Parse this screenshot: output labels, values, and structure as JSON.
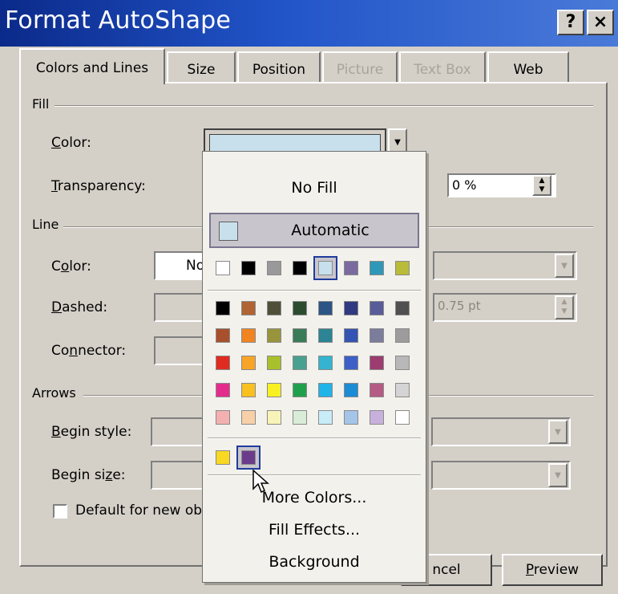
{
  "window": {
    "title": "Format AutoShape",
    "help_label": "?",
    "close_label": "×"
  },
  "tabs": [
    {
      "label": "Colors and Lines",
      "active": true,
      "enabled": true
    },
    {
      "label": "Size",
      "active": false,
      "enabled": true
    },
    {
      "label": "Position",
      "active": false,
      "enabled": true
    },
    {
      "label": "Picture",
      "active": false,
      "enabled": false
    },
    {
      "label": "Text Box",
      "active": false,
      "enabled": false
    },
    {
      "label": "Web",
      "active": false,
      "enabled": true
    }
  ],
  "fill": {
    "section": "Fill",
    "color_label": "Color:",
    "color_value": "#c8e0ec",
    "transparency_label": "Transparency:",
    "transparency_value": "0 %"
  },
  "line": {
    "section": "Line",
    "color_label": "Color:",
    "color_value": "No",
    "dashed_label": "Dashed:",
    "connector_label": "Connector:",
    "weight_value": "0.75 pt"
  },
  "arrows": {
    "section": "Arrows",
    "begin_style_label": "Begin style:",
    "begin_size_label": "Begin size:"
  },
  "default_checkbox": {
    "label": "Default for new ob",
    "checked": false
  },
  "buttons": {
    "cancel": "ncel",
    "preview": "Preview"
  },
  "palette": {
    "no_fill": "No Fill",
    "automatic": "Automatic",
    "automatic_color": "#c8e0ec",
    "scheme_colors": [
      "#ffffff",
      "#000000",
      "#999999",
      "#000000",
      "#c8e0ec",
      "#7b6aa0",
      "#2f98b8",
      "#b8bc38"
    ],
    "selected_scheme_index": 4,
    "standard_colors": [
      [
        "#000000",
        "#b06434",
        "#505038",
        "#2c4c30",
        "#2c5484",
        "#303a80",
        "#585c98",
        "#505050"
      ],
      [
        "#a8502c",
        "#f08420",
        "#98943c",
        "#3a7c58",
        "#2c8494",
        "#3454b4",
        "#7c7c9c",
        "#9c9c9c"
      ],
      [
        "#e02c20",
        "#f8a428",
        "#a8c02c",
        "#48a090",
        "#34b4d0",
        "#3c60c8",
        "#9c3c70",
        "#b8b8b8"
      ],
      [
        "#e42c8c",
        "#f8c020",
        "#f8f020",
        "#20a04c",
        "#20b4e8",
        "#1c8cd4",
        "#b45c84",
        "#d4d4d4"
      ],
      [
        "#f4b0b0",
        "#f8d0a8",
        "#f8f4b8",
        "#d8ecd8",
        "#c8ecf8",
        "#a4c4e8",
        "#c8b0dc",
        "#ffffff"
      ]
    ],
    "recent_colors": [
      "#f8d820",
      "#6c3c8c"
    ],
    "selected_recent_index": 1,
    "more_colors": "More Colors...",
    "fill_effects": "Fill Effects...",
    "background": "Background"
  }
}
